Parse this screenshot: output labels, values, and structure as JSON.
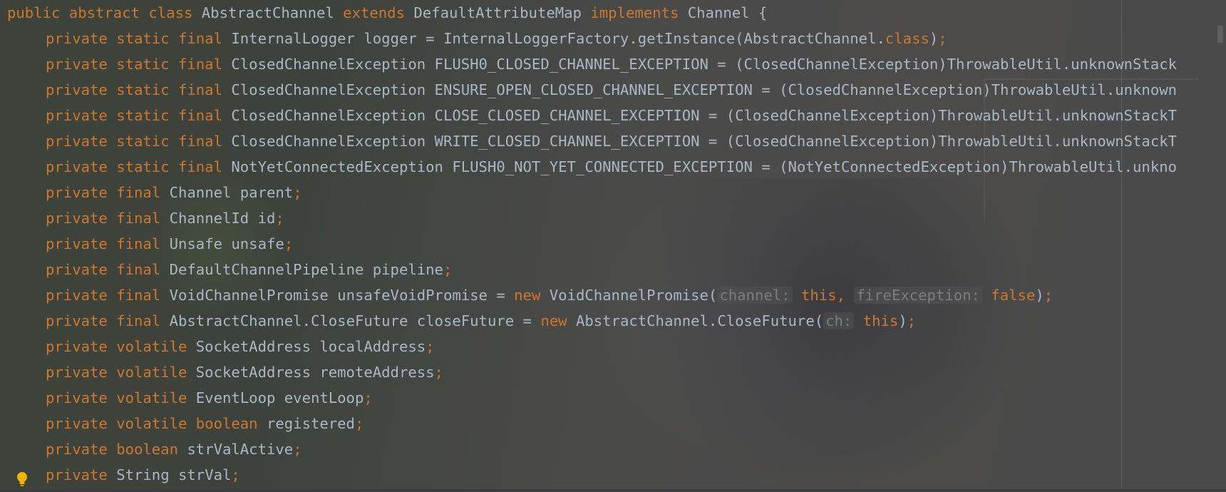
{
  "editor": {
    "lines": [
      {
        "indent": "",
        "tokens": [
          {
            "t": "public abstract class ",
            "c": "kw"
          },
          {
            "t": "AbstractChannel ",
            "c": "cls"
          },
          {
            "t": "extends ",
            "c": "kw"
          },
          {
            "t": "DefaultAttributeMap ",
            "c": "cls"
          },
          {
            "t": "implements ",
            "c": "kw"
          },
          {
            "t": "Channel {",
            "c": "cls"
          }
        ]
      },
      {
        "indent": "    ",
        "tokens": [
          {
            "t": "private static final ",
            "c": "kw"
          },
          {
            "t": "InternalLogger logger = InternalLoggerFactory.getInstance(AbstractChannel.",
            "c": "cls"
          },
          {
            "t": "class",
            "c": "kw"
          },
          {
            "t": ")",
            "c": "cls"
          },
          {
            "t": ";",
            "c": "kw"
          }
        ]
      },
      {
        "indent": "    ",
        "tokens": [
          {
            "t": "private static final ",
            "c": "kw"
          },
          {
            "t": "ClosedChannelException FLUSH0_CLOSED_CHANNEL_EXCEPTION = (ClosedChannelException)ThrowableUtil.unknownStack",
            "c": "cls"
          }
        ]
      },
      {
        "indent": "    ",
        "tokens": [
          {
            "t": "private static final ",
            "c": "kw"
          },
          {
            "t": "ClosedChannelException ENSURE_OPEN_CLOSED_CHANNEL_EXCEPTION = (ClosedChannelException)ThrowableUtil.unknown",
            "c": "cls"
          }
        ]
      },
      {
        "indent": "    ",
        "tokens": [
          {
            "t": "private static final ",
            "c": "kw"
          },
          {
            "t": "ClosedChannelException CLOSE_CLOSED_CHANNEL_EXCEPTION = (ClosedChannelException)ThrowableUtil.unknownStackT",
            "c": "cls"
          }
        ]
      },
      {
        "indent": "    ",
        "tokens": [
          {
            "t": "private static final ",
            "c": "kw"
          },
          {
            "t": "ClosedChannelException WRITE_CLOSED_CHANNEL_EXCEPTION = (ClosedChannelException)ThrowableUtil.unknownStackT",
            "c": "cls"
          }
        ]
      },
      {
        "indent": "    ",
        "tokens": [
          {
            "t": "private static final ",
            "c": "kw"
          },
          {
            "t": "NotYetConnectedException FLUSH0_NOT_YET_CONNECTED_EXCEPTION = (NotYetConnectedException)ThrowableUtil.unkno",
            "c": "cls"
          }
        ]
      },
      {
        "indent": "    ",
        "tokens": [
          {
            "t": "private final ",
            "c": "kw"
          },
          {
            "t": "Channel parent",
            "c": "cls"
          },
          {
            "t": ";",
            "c": "kw"
          }
        ]
      },
      {
        "indent": "    ",
        "tokens": [
          {
            "t": "private final ",
            "c": "kw"
          },
          {
            "t": "ChannelId id",
            "c": "cls"
          },
          {
            "t": ";",
            "c": "kw"
          }
        ]
      },
      {
        "indent": "    ",
        "tokens": [
          {
            "t": "private final ",
            "c": "kw"
          },
          {
            "t": "Unsafe unsafe",
            "c": "cls"
          },
          {
            "t": ";",
            "c": "kw"
          }
        ]
      },
      {
        "indent": "    ",
        "tokens": [
          {
            "t": "private final ",
            "c": "kw"
          },
          {
            "t": "DefaultChannelPipeline pipeline",
            "c": "cls"
          },
          {
            "t": ";",
            "c": "kw"
          }
        ]
      },
      {
        "indent": "    ",
        "tokens": [
          {
            "t": "private final ",
            "c": "kw"
          },
          {
            "t": "VoidChannelPromise unsafeVoidPromise = ",
            "c": "cls"
          },
          {
            "t": "new ",
            "c": "kw"
          },
          {
            "t": "VoidChannelPromise(",
            "c": "cls"
          },
          {
            "t": "channel:",
            "c": "hint"
          },
          {
            "t": " ",
            "c": "cls"
          },
          {
            "t": "this, ",
            "c": "kw"
          },
          {
            "t": "fireException:",
            "c": "hint"
          },
          {
            "t": " ",
            "c": "cls"
          },
          {
            "t": "false",
            "c": "kw"
          },
          {
            "t": ")",
            "c": "cls"
          },
          {
            "t": ";",
            "c": "kw"
          }
        ]
      },
      {
        "indent": "    ",
        "tokens": [
          {
            "t": "private final ",
            "c": "kw"
          },
          {
            "t": "AbstractChannel.CloseFuture closeFuture = ",
            "c": "cls"
          },
          {
            "t": "new ",
            "c": "kw"
          },
          {
            "t": "AbstractChannel.CloseFuture(",
            "c": "cls"
          },
          {
            "t": "ch:",
            "c": "hint"
          },
          {
            "t": " ",
            "c": "cls"
          },
          {
            "t": "this",
            "c": "kw"
          },
          {
            "t": ")",
            "c": "cls"
          },
          {
            "t": ";",
            "c": "kw"
          }
        ]
      },
      {
        "indent": "    ",
        "tokens": [
          {
            "t": "private volatile ",
            "c": "kw"
          },
          {
            "t": "SocketAddress localAddress",
            "c": "cls"
          },
          {
            "t": ";",
            "c": "kw"
          }
        ]
      },
      {
        "indent": "    ",
        "tokens": [
          {
            "t": "private volatile ",
            "c": "kw"
          },
          {
            "t": "SocketAddress remoteAddress",
            "c": "cls"
          },
          {
            "t": ";",
            "c": "kw"
          }
        ]
      },
      {
        "indent": "    ",
        "tokens": [
          {
            "t": "private volatile ",
            "c": "kw"
          },
          {
            "t": "EventLoop eventLoop",
            "c": "cls"
          },
          {
            "t": ";",
            "c": "kw"
          }
        ]
      },
      {
        "indent": "    ",
        "tokens": [
          {
            "t": "private volatile boolean ",
            "c": "kw"
          },
          {
            "t": "registered",
            "c": "cls"
          },
          {
            "t": ";",
            "c": "kw"
          }
        ]
      },
      {
        "indent": "    ",
        "tokens": [
          {
            "t": "private boolean ",
            "c": "kw"
          },
          {
            "t": "strValActive",
            "c": "cls"
          },
          {
            "t": ";",
            "c": "kw"
          }
        ]
      },
      {
        "indent": "    ",
        "tokens": [
          {
            "t": "private ",
            "c": "kw"
          },
          {
            "t": "String strVal",
            "c": "cls"
          },
          {
            "t": ";",
            "c": "kw"
          }
        ]
      }
    ],
    "intention_icon": "lightbulb-icon"
  },
  "colors": {
    "keyword": "#cc7832",
    "text": "#a9b7c6",
    "hint": "#7b7e80",
    "background": "#3c3f41"
  }
}
